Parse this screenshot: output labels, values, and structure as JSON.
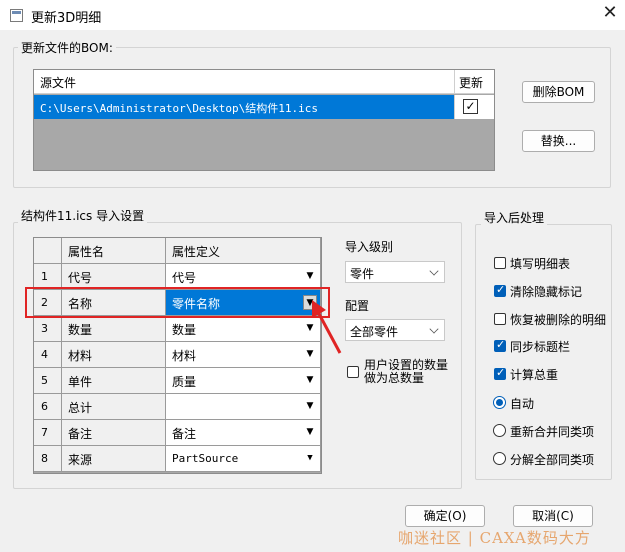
{
  "window": {
    "title": "更新3D明细",
    "close_glyph": "✕"
  },
  "bom_group": {
    "legend": "更新文件的BOM:",
    "columns": [
      "源文件",
      "更新"
    ],
    "rows": [
      {
        "path": "C:\\Users\\Administrator\\Desktop\\结构件11.ics",
        "update_checked": true
      }
    ],
    "delete_button": "删除BOM",
    "replace_button": "替换..."
  },
  "import_group": {
    "legend": "结构件11.ics 导入设置",
    "columns": [
      "属性名",
      "属性定义"
    ],
    "rows": [
      {
        "num": "1",
        "name": "代号",
        "def": "代号",
        "mono": false,
        "selected": false
      },
      {
        "num": "2",
        "name": "名称",
        "def": "零件名称",
        "mono": false,
        "selected": true
      },
      {
        "num": "3",
        "name": "数量",
        "def": "数量",
        "mono": false,
        "selected": false
      },
      {
        "num": "4",
        "name": "材料",
        "def": "材料",
        "mono": false,
        "selected": false
      },
      {
        "num": "5",
        "name": "单件",
        "def": "质量",
        "mono": false,
        "selected": false
      },
      {
        "num": "6",
        "name": "总计",
        "def": "",
        "mono": false,
        "selected": false
      },
      {
        "num": "7",
        "name": "备注",
        "def": "备注",
        "mono": false,
        "selected": false
      },
      {
        "num": "8",
        "name": "来源",
        "def": "PartSource",
        "mono": true,
        "selected": false
      }
    ],
    "import_level_label": "导入级别",
    "import_level_value": "零件",
    "config_label": "配置",
    "config_value": "全部零件",
    "user_qty_label_line1": "用户设置的数量",
    "user_qty_label_line2": "做为总数量",
    "user_qty_checked": false
  },
  "post_group": {
    "legend": "导入后处理",
    "checkboxes": [
      {
        "label": "填写明细表",
        "checked": false
      },
      {
        "label": "清除隐藏标记",
        "checked": true
      },
      {
        "label": "恢复被删除的明细",
        "checked": false
      },
      {
        "label": "同步标题栏",
        "checked": true
      },
      {
        "label": "计算总重",
        "checked": true
      }
    ],
    "radios": [
      {
        "label": "自动",
        "checked": true
      },
      {
        "label": "重新合并同类项",
        "checked": false
      },
      {
        "label": "分解全部同类项",
        "checked": false
      }
    ]
  },
  "footer": {
    "ok_button": "确定(O)",
    "cancel_button": "取消(C)"
  },
  "watermark": "咖迷社区 | CAXA数码大方",
  "colors": {
    "selection": "#0078d7",
    "annotation_red": "#e02424",
    "checkbox_blue": "#005fb8"
  }
}
